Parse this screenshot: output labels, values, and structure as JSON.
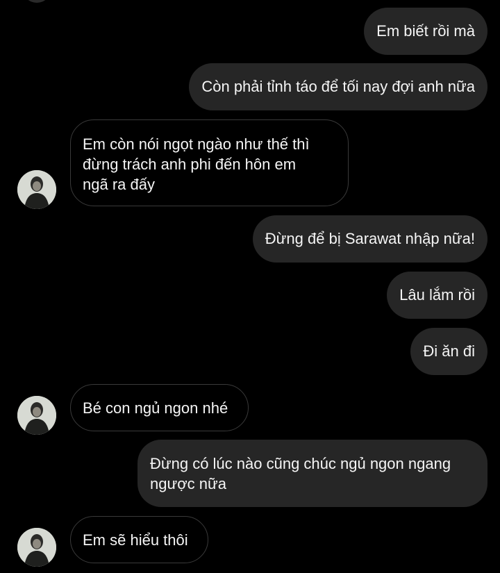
{
  "conversation": {
    "messages": [
      {
        "direction": "out",
        "text": "Em biết rồi mà"
      },
      {
        "direction": "out",
        "text": "Còn phải tỉnh táo để tối nay đợi anh nữa"
      },
      {
        "direction": "in",
        "text": "Em còn nói ngọt ngào như thế thì\nđừng trách anh phi đến hôn em\nngã ra đấy"
      },
      {
        "direction": "out",
        "text": "Đừng để bị Sarawat nhập nữa!"
      },
      {
        "direction": "out",
        "text": "Lâu lắm rồi"
      },
      {
        "direction": "out",
        "text": "Đi ăn đi"
      },
      {
        "direction": "in",
        "text": "Bé con ngủ ngon nhé"
      },
      {
        "direction": "out",
        "text": "Đừng có lúc nào cũng chúc ngủ ngon ngang\nngược nữa"
      },
      {
        "direction": "in",
        "text": "Em sẽ hiểu thôi"
      }
    ],
    "contact_avatar_icon": "contact-avatar-icon",
    "colors": {
      "background": "#000000",
      "outgoing_bubble": "#262626",
      "incoming_border": "#3a3a3a",
      "text": "#f5f5f5"
    }
  }
}
